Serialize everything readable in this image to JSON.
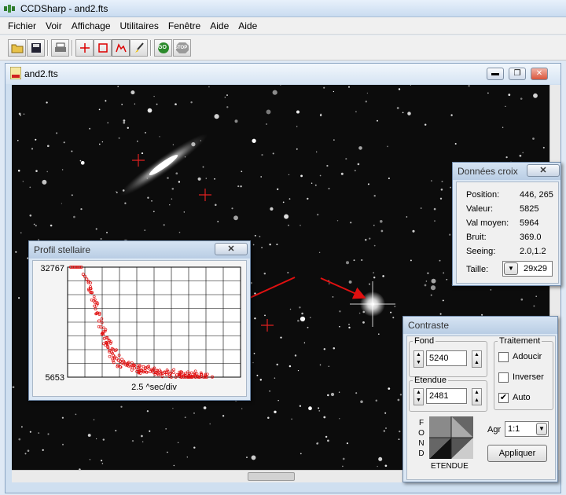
{
  "app": {
    "title": "CCDSharp - and2.fts"
  },
  "menu": [
    "Fichier",
    "Voir",
    "Affichage",
    "Utilitaires",
    "Fenêtre",
    "Aide",
    "Aide"
  ],
  "toolbar": {
    "go_label": "GO",
    "stop_label": "STOP"
  },
  "child": {
    "title": "and2.fts",
    "minimize": "▬",
    "restore": "❐",
    "close": "✕"
  },
  "profile": {
    "title": "Profil stellaire",
    "close": "✕",
    "chart_data": {
      "type": "scatter",
      "title": "",
      "xlabel": "2.5 ^sec/div",
      "ylabel": "",
      "ylim": [
        5653,
        32767
      ],
      "y_tick_labels": [
        "32767",
        "5653"
      ],
      "series": [
        {
          "values_approx": [
            [
              0,
              32767
            ],
            [
              1,
              32767
            ],
            [
              2,
              32767
            ],
            [
              3,
              32767
            ],
            [
              4,
              32767
            ],
            [
              5,
              32767
            ],
            [
              6,
              32767
            ],
            [
              7,
              31000
            ],
            [
              8,
              30500
            ],
            [
              9,
              29800
            ],
            [
              10,
              29000
            ],
            [
              11,
              27500
            ],
            [
              12,
              26500
            ],
            [
              13,
              24500
            ],
            [
              14,
              22500
            ],
            [
              15,
              21500
            ],
            [
              16,
              19500
            ],
            [
              17,
              18000
            ],
            [
              18,
              16500
            ],
            [
              19,
              15200
            ],
            [
              20,
              14200
            ],
            [
              21,
              13000
            ],
            [
              22,
              12300
            ],
            [
              23,
              11800
            ],
            [
              24,
              11000
            ],
            [
              25,
              10600
            ],
            [
              26,
              10200
            ],
            [
              27,
              9800
            ],
            [
              28,
              9500
            ],
            [
              29,
              9200
            ],
            [
              30,
              9000
            ],
            [
              32,
              8600
            ],
            [
              34,
              8200
            ],
            [
              36,
              7900
            ],
            [
              38,
              7600
            ],
            [
              40,
              7400
            ],
            [
              42,
              7200
            ],
            [
              45,
              7000
            ],
            [
              48,
              6800
            ],
            [
              52,
              6600
            ],
            [
              56,
              6400
            ],
            [
              60,
              6200
            ],
            [
              64,
              6000
            ],
            [
              68,
              5900
            ],
            [
              72,
              5800
            ],
            [
              76,
              5750
            ],
            [
              80,
              5700
            ]
          ]
        }
      ]
    }
  },
  "donnees": {
    "title": "Données croix",
    "close": "✕",
    "rows": [
      {
        "label": "Position:",
        "value": "446, 265"
      },
      {
        "label": "Valeur:",
        "value": "5825"
      },
      {
        "label": "Val moyen:",
        "value": "5964"
      },
      {
        "label": "Bruit:",
        "value": "369.0"
      },
      {
        "label": "Seeing:",
        "value": "2.0,1.2"
      }
    ],
    "taille_label": "Taille:",
    "taille_value": "29x29",
    "taille_arrow": "▼"
  },
  "contraste": {
    "title": "Contraste",
    "close": "✕",
    "fond_label": "Fond",
    "fond_value": "5240",
    "etendue_label": "Etendue",
    "etendue_value": "2481",
    "traitement_label": "Traitement",
    "adoucir": "Adoucir",
    "inverser": "Inverser",
    "auto": "Auto",
    "auto_checked": "✔",
    "fond_vertical": [
      "F",
      "O",
      "N",
      "D"
    ],
    "etendue_caption": "ETENDUE",
    "agr_label": "Agr",
    "agr_value": "1:1",
    "agr_arrow": "▼",
    "appliquer": "Appliquer"
  }
}
